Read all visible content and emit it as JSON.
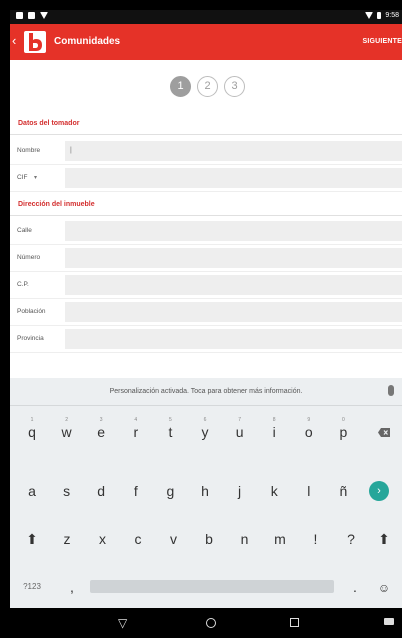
{
  "status_bar": {
    "time": "9:58",
    "left_icons": [
      "twitter-icon",
      "gmail-icon",
      "location-icon"
    ],
    "right_icons": [
      "wifi-icon",
      "battery-icon"
    ]
  },
  "app_bar": {
    "back_icon": "chevron-left-icon",
    "logo": "b-logo-icon",
    "title": "Comunidades",
    "next_label": "SIGUIENTE",
    "color": "#e53228"
  },
  "steps": [
    "1",
    "2",
    "3"
  ],
  "active_step": 1,
  "sections": {
    "tomador": {
      "title": "Datos del tomador",
      "rows": [
        {
          "label": "Nombre",
          "value": "|"
        },
        {
          "label": "CIF",
          "value": ""
        }
      ]
    },
    "inmueble": {
      "title": "Dirección del inmueble",
      "rows": [
        {
          "label": "Calle",
          "value": ""
        },
        {
          "label": "Número",
          "value": ""
        },
        {
          "label": "C.P.",
          "value": ""
        },
        {
          "label": "Población",
          "value": ""
        },
        {
          "label": "Provincia",
          "value": ""
        }
      ]
    }
  },
  "keyboard": {
    "suggestion": "Personalización activada. Toca para obtener más información.",
    "row1": [
      "q",
      "w",
      "e",
      "r",
      "t",
      "y",
      "u",
      "i",
      "o",
      "p"
    ],
    "row1_hints": [
      "1",
      "2",
      "3",
      "4",
      "5",
      "6",
      "7",
      "8",
      "9",
      "0"
    ],
    "row2": [
      "a",
      "s",
      "d",
      "f",
      "g",
      "h",
      "j",
      "k",
      "l",
      "ñ"
    ],
    "row3": [
      "z",
      "x",
      "c",
      "v",
      "b",
      "n",
      "m",
      "!",
      "?"
    ],
    "symbols_label": "?123",
    "comma": ",",
    "period": ".",
    "enter_color": "#26a69a"
  },
  "nav_bar": {
    "buttons": [
      "back-triangle-icon",
      "home-circle-icon",
      "recents-square-icon",
      "keyboard-icon"
    ]
  }
}
